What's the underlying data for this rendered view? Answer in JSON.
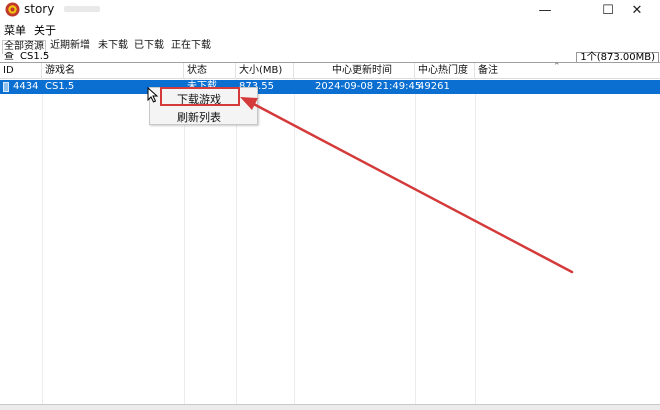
{
  "window": {
    "title": "story",
    "minimize_glyph": "—",
    "maximize_glyph": "☐",
    "close_glyph": "✕"
  },
  "menu": {
    "items": [
      "菜单",
      "关于"
    ]
  },
  "tabs": [
    {
      "label": "全部资源",
      "active": true
    },
    {
      "label": "近期新增",
      "active": false
    },
    {
      "label": "未下载",
      "active": false
    },
    {
      "label": "已下载",
      "active": false
    },
    {
      "label": "正在下载",
      "active": false
    }
  ],
  "summary": "1个(873.00MB)",
  "search": {
    "label": "查",
    "value": "CS1.5"
  },
  "table": {
    "columns": [
      "ID",
      "游戏名",
      "状态",
      "大小(MB)",
      "中心更新时间",
      "中心热门度",
      "备注"
    ],
    "rows": [
      {
        "id": "4434",
        "name": "CS1.5",
        "status": "未下载",
        "size": "873.55",
        "updated": "2024-09-08 21:49:45",
        "popularity": "49261",
        "note": ""
      }
    ]
  },
  "context_menu": {
    "items": [
      "下载游戏",
      "刷新列表"
    ]
  },
  "colors": {
    "selection": "#0a6fd1",
    "annotation": "#d43a3a"
  },
  "icons": {
    "app": "app-emblem-icon",
    "cursor": "mouse-cursor-icon"
  }
}
